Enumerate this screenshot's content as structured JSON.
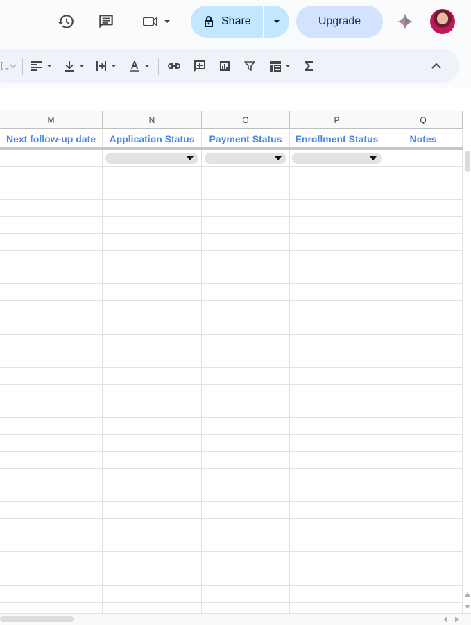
{
  "topbar": {
    "share_label": "Share",
    "upgrade_label": "Upgrade",
    "icons": [
      "history-icon",
      "comment-icon",
      "meet-icon",
      "lock-icon",
      "gemini-icon"
    ]
  },
  "toolbar": {
    "icons": [
      "borders-icon",
      "align-left-icon",
      "vertical-align-icon",
      "text-wrap-icon",
      "text-rotation-icon",
      "link-icon",
      "insert-comment-icon",
      "insert-chart-icon",
      "filter-icon",
      "filter-views-icon",
      "functions-icon",
      "collapse-toolbar-icon"
    ]
  },
  "sheet": {
    "column_letters": [
      "M",
      "N",
      "O",
      "P",
      "Q"
    ],
    "headers": [
      "Next follow-up date",
      "Application Status",
      "Payment Status",
      "Enrollment Status",
      "Notes"
    ],
    "dropdown_columns": [
      "N",
      "O",
      "P"
    ]
  },
  "colors": {
    "accent": "#4a86e8",
    "share_bg": "#c2e7ff",
    "upgrade_bg": "#d3e3fd"
  }
}
